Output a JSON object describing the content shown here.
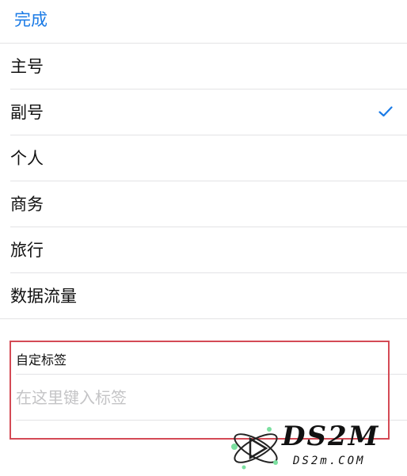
{
  "nav": {
    "done_label": "完成"
  },
  "labels": [
    {
      "label": "主号",
      "selected": false
    },
    {
      "label": "副号",
      "selected": true
    },
    {
      "label": "个人",
      "selected": false
    },
    {
      "label": "商务",
      "selected": false
    },
    {
      "label": "旅行",
      "selected": false
    },
    {
      "label": "数据流量",
      "selected": false
    }
  ],
  "custom_label": {
    "title": "自定标签",
    "placeholder": "在这里键入标签",
    "value": ""
  },
  "watermark": {
    "title": "DS2M",
    "subtitle": "DS2m.COM"
  },
  "colors": {
    "accent": "#1b7be6",
    "separator": "#e3e3e5",
    "highlight": "#d44a55"
  },
  "icons": {
    "selected": "checkmark-icon"
  }
}
